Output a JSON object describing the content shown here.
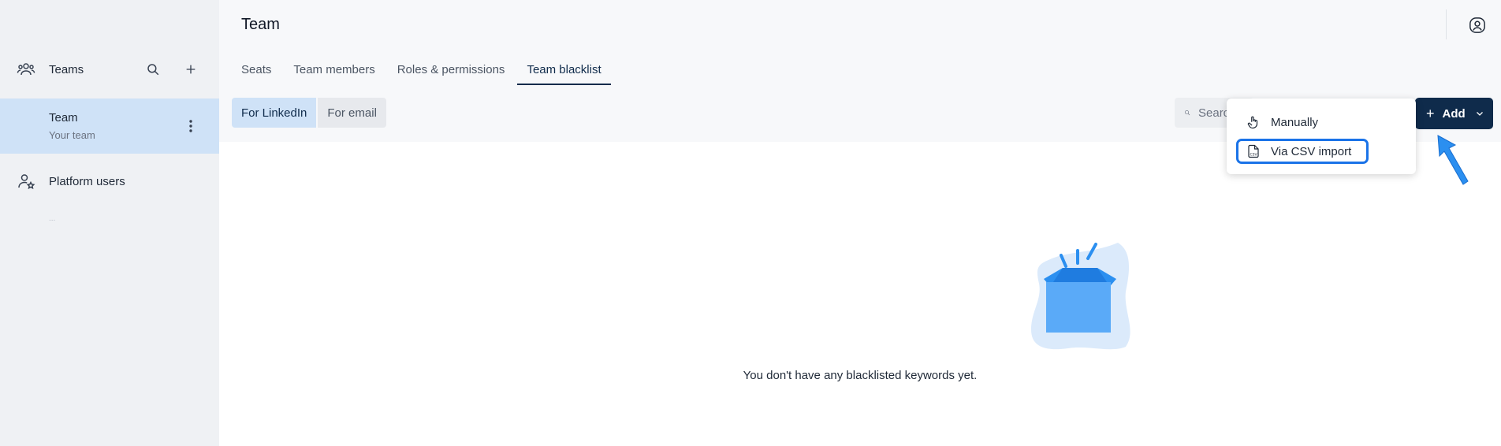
{
  "sidebar": {
    "teams_label": "Teams",
    "team_item": {
      "title": "Team",
      "subtitle": "Your team"
    },
    "platform_users_label": "Platform users",
    "dots": "..."
  },
  "header": {
    "title": "Team"
  },
  "tabs": [
    {
      "label": "Seats"
    },
    {
      "label": "Team members"
    },
    {
      "label": "Roles & permissions"
    },
    {
      "label": "Team blacklist",
      "active": true
    }
  ],
  "filters": {
    "linkedin_label": "For LinkedIn",
    "email_label": "For email",
    "active": "For LinkedIn"
  },
  "search": {
    "placeholder": "Search"
  },
  "add_button": {
    "label": "Add"
  },
  "dropdown": {
    "items": [
      {
        "label": "Manually",
        "icon": "hand-pointer-icon"
      },
      {
        "label": "Via CSV import",
        "icon": "csv-file-icon",
        "highlighted": true
      }
    ]
  },
  "empty_state": {
    "message": "You don't have any blacklisted keywords yet."
  },
  "colors": {
    "accent": "#0f2b4b",
    "selected_bg": "#cfe2f7",
    "highlight": "#1a73e8",
    "illustration": "#2b8ff0"
  }
}
